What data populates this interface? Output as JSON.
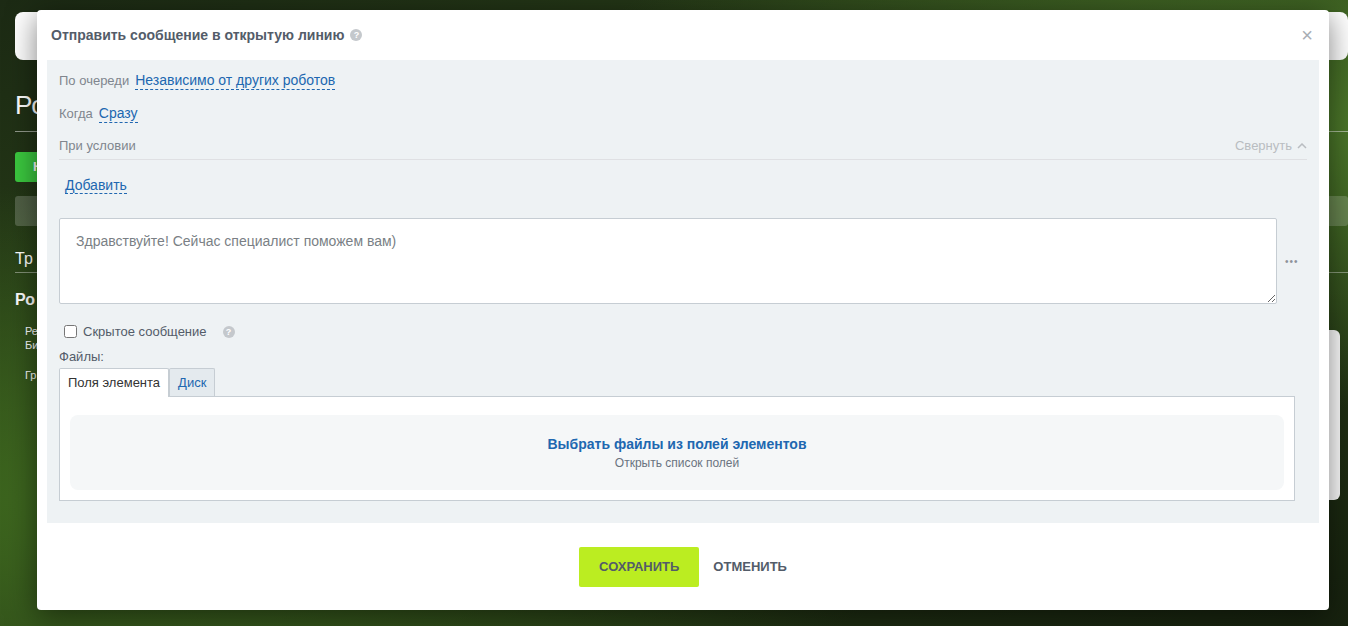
{
  "page": {
    "heading": "Ро",
    "button": "Н",
    "sections": [
      "Тр",
      "Ро"
    ],
    "small_texts": [
      "Ре",
      "Би",
      "Гр"
    ]
  },
  "dialog": {
    "title": "Отправить сообщение в открытую линию",
    "help": "?",
    "close": "×"
  },
  "settings": [
    {
      "label": "По очереди",
      "value": "Независимо от других роботов"
    },
    {
      "label": "Когда",
      "value": "Сразу"
    }
  ],
  "condition": {
    "label": "При условии",
    "toggle": "Свернуть",
    "expanded": true,
    "add": "Добавить"
  },
  "message": {
    "value": "Здравствуйте! Сейчас специалист поможем вам)",
    "menu": "•••"
  },
  "hidden": {
    "label": "Скрытое сообщение",
    "checked": false,
    "help": "?"
  },
  "files": {
    "label": "Файлы:",
    "tabs": [
      {
        "label": "Поля элемента",
        "selected": true
      },
      {
        "label": "Диск",
        "selected": false
      }
    ],
    "picker_title": "Выбрать файлы из полей элементов",
    "picker_hint": "Открыть список полей"
  },
  "buttons": [
    {
      "label": "СОХРАНИТЬ",
      "kind": "primary"
    },
    {
      "label": "ОТМЕНИТЬ",
      "kind": "link"
    }
  ]
}
